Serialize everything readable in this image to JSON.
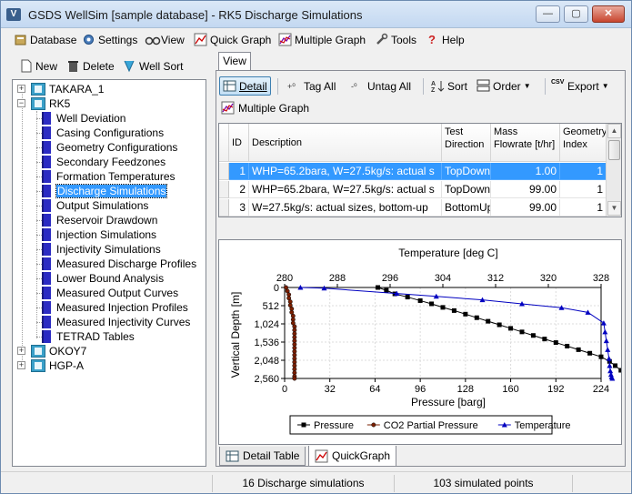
{
  "window": {
    "title": "GSDS WellSim [sample database] - RK5 Discharge Simulations",
    "app_icon": "V",
    "controls": {
      "minimize": "—",
      "maximize": "▢",
      "close": "✕"
    }
  },
  "menu": [
    {
      "label": "Database",
      "icon": "database-icon"
    },
    {
      "label": "Settings",
      "icon": "gear-icon"
    },
    {
      "label": "View",
      "icon": "binoculars-icon"
    },
    {
      "label": "Quick Graph",
      "icon": "chart-icon"
    },
    {
      "label": "Multiple Graph",
      "icon": "chart-icon"
    },
    {
      "label": "Tools",
      "icon": "tools-icon"
    },
    {
      "label": "Help",
      "icon": "help-icon"
    }
  ],
  "left_toolbar": {
    "new": "New",
    "delete": "Delete",
    "well_sort": "Well Sort"
  },
  "tree": {
    "wells": [
      {
        "label": "TAKARA_1",
        "expanded": false
      },
      {
        "label": "RK5",
        "expanded": true
      },
      {
        "label": "OKOY7",
        "expanded": false
      },
      {
        "label": "HGP-A",
        "expanded": false
      }
    ],
    "rk5_children": [
      "Well Deviation",
      "Casing Configurations",
      "Geometry Configurations",
      "Secondary Feedzones",
      "Formation Temperatures",
      "Discharge Simulations",
      "Output Simulations",
      "Reservoir Drawdown",
      "Injection Simulations",
      "Injectivity Simulations",
      "Measured Discharge Profiles",
      "Lower Bound Analysis",
      "Measured Output Curves",
      "Measured Injection Profiles",
      "Measured Injectivity Curves",
      "TETRAD Tables"
    ],
    "selected": "Discharge Simulations"
  },
  "view_tab": "View",
  "right_toolbar": {
    "detail": "Detail",
    "tag_all": "Tag All",
    "untag_all": "Untag All",
    "sort": "Sort",
    "order": "Order",
    "export": "Export",
    "export_icon_text": "CSV",
    "multiple_graph": "Multiple Graph"
  },
  "grid": {
    "columns": [
      {
        "label": "ID"
      },
      {
        "label": "Description"
      },
      {
        "label": "Test Direction"
      },
      {
        "label": "Mass Flowrate [t/hr]"
      },
      {
        "label": "Geometry Index"
      }
    ],
    "rows": [
      {
        "id": "1",
        "description": "WHP=65.2bara, W=27.5kg/s: actual s",
        "direction": "TopDown",
        "flow": "1.00",
        "geom": "1",
        "selected": true
      },
      {
        "id": "2",
        "description": "WHP=65.2bara, W=27.5kg/s: actual s",
        "direction": "TopDown",
        "flow": "99.00",
        "geom": "1",
        "selected": false
      },
      {
        "id": "3",
        "description": "W=27.5kg/s: actual sizes, bottom-up",
        "direction": "BottomUp",
        "flow": "99.00",
        "geom": "1",
        "selected": false
      }
    ]
  },
  "chart_data": {
    "type": "line",
    "title": "",
    "xlabel": "Pressure [barg]",
    "x2label": "Temperature [deg C]",
    "ylabel": "Vertical Depth [m]",
    "x_ticks": [
      "0",
      "32",
      "64",
      "96",
      "128",
      "160",
      "192",
      "224"
    ],
    "x2_ticks": [
      "280",
      "288",
      "296",
      "304",
      "312",
      "320",
      "328"
    ],
    "y_ticks": [
      "0",
      "512",
      "1,024",
      "1,536",
      "2,048",
      "2,560"
    ],
    "xlim": [
      0,
      224
    ],
    "x2lim": [
      280,
      328
    ],
    "ylim": [
      2560,
      0
    ],
    "y_reversed": true,
    "grid": true,
    "legend_position": "bottom",
    "series": [
      {
        "name": "Pressure",
        "axis": "bottom",
        "color": "#000000",
        "marker": "square",
        "points": [
          [
            66,
            0
          ],
          [
            72,
            80
          ],
          [
            78,
            180
          ],
          [
            87,
            270
          ],
          [
            96,
            370
          ],
          [
            104,
            460
          ],
          [
            112,
            560
          ],
          [
            120,
            650
          ],
          [
            128,
            750
          ],
          [
            136,
            850
          ],
          [
            144,
            950
          ],
          [
            152,
            1050
          ],
          [
            160,
            1150
          ],
          [
            168,
            1250
          ],
          [
            176,
            1350
          ],
          [
            184,
            1450
          ],
          [
            192,
            1550
          ],
          [
            200,
            1650
          ],
          [
            208,
            1750
          ],
          [
            216,
            1850
          ],
          [
            224,
            1950
          ],
          [
            230,
            2080
          ],
          [
            234,
            2200
          ],
          [
            238,
            2330
          ],
          [
            242,
            2440
          ],
          [
            244,
            2520
          ],
          [
            246,
            2560
          ]
        ]
      },
      {
        "name": "CO2 Partial Pressure",
        "axis": "bottom",
        "color": "#7a1f00",
        "marker": "circle",
        "points": [
          [
            1,
            0
          ],
          [
            2,
            100
          ],
          [
            3,
            200
          ],
          [
            3,
            300
          ],
          [
            4,
            400
          ],
          [
            4,
            500
          ],
          [
            5,
            600
          ],
          [
            5,
            700
          ],
          [
            6,
            800
          ],
          [
            6,
            900
          ],
          [
            6,
            1000
          ],
          [
            7,
            1100
          ],
          [
            7,
            1200
          ],
          [
            7,
            1300
          ],
          [
            7,
            1400
          ],
          [
            7,
            1500
          ],
          [
            7,
            1600
          ],
          [
            7,
            1700
          ],
          [
            7,
            1800
          ],
          [
            7,
            1900
          ],
          [
            7,
            2000
          ],
          [
            7,
            2100
          ],
          [
            7,
            2200
          ],
          [
            7,
            2300
          ],
          [
            7,
            2400
          ],
          [
            7,
            2500
          ],
          [
            7,
            2560
          ]
        ]
      },
      {
        "name": "Temperature",
        "axis": "top",
        "color": "#0000c0",
        "marker": "triangle",
        "points": [
          [
            282.4,
            0
          ],
          [
            286,
            20
          ],
          [
            297,
            170
          ],
          [
            303,
            250
          ],
          [
            310,
            350
          ],
          [
            316,
            460
          ],
          [
            322,
            570
          ],
          [
            326,
            700
          ],
          [
            328.4,
            1000
          ],
          [
            328.6,
            1250
          ],
          [
            328.8,
            1500
          ],
          [
            329.0,
            1750
          ],
          [
            329.2,
            2000
          ],
          [
            329.3,
            2200
          ],
          [
            329.4,
            2350
          ],
          [
            329.5,
            2450
          ],
          [
            329.6,
            2520
          ],
          [
            329.7,
            2560
          ]
        ]
      }
    ]
  },
  "bottom_tabs": {
    "detail_table": "Detail Table",
    "quick_graph": "QuickGraph"
  },
  "status": {
    "p1": "",
    "p2": "16 Discharge simulations",
    "p3": "103 simulated points",
    "p4": ""
  }
}
